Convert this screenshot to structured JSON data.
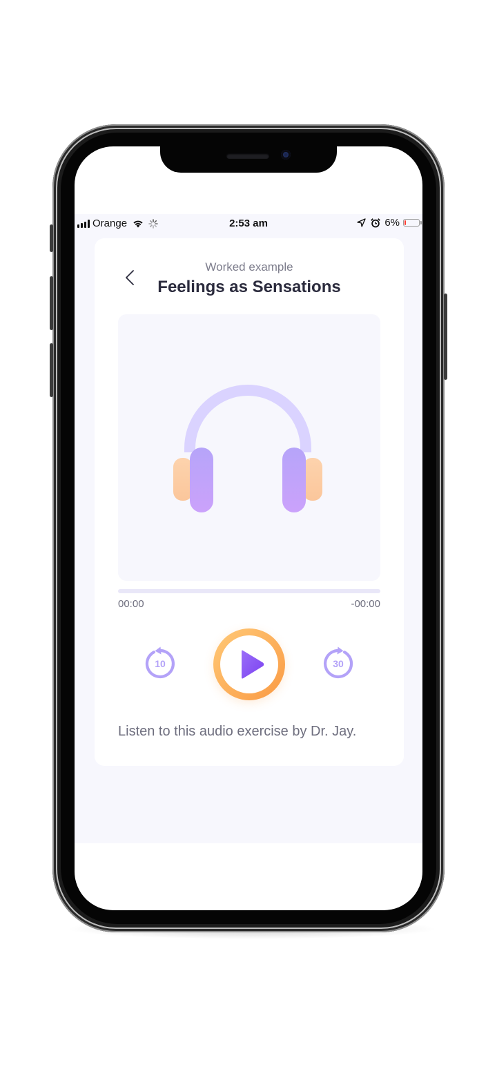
{
  "status_bar": {
    "carrier": "Orange",
    "time": "2:53 am",
    "battery_percent": "6%",
    "battery_level": 0.06
  },
  "header": {
    "subtitle": "Worked example",
    "title": "Feelings as Sensations"
  },
  "player": {
    "elapsed": "00:00",
    "remaining": "-00:00",
    "progress": 0,
    "skip_back_seconds": "10",
    "skip_forward_seconds": "30"
  },
  "description": "Listen to this audio exercise by Dr. Jay.",
  "icons": {
    "back": "chevron-left-icon",
    "artwork": "headphones-icon",
    "play": "play-icon",
    "skip_back": "rewind-10-icon",
    "skip_forward": "forward-30-icon"
  },
  "colors": {
    "accent_purple": "#a98cf8",
    "play_orange": "#fa9a44",
    "play_gradient_start": "#ffc977",
    "headphone_band": "#dad3ff",
    "headphone_cup": "#c2a1fb",
    "ear_pad": "#fcc9a0",
    "background": "#f7f7fd"
  }
}
